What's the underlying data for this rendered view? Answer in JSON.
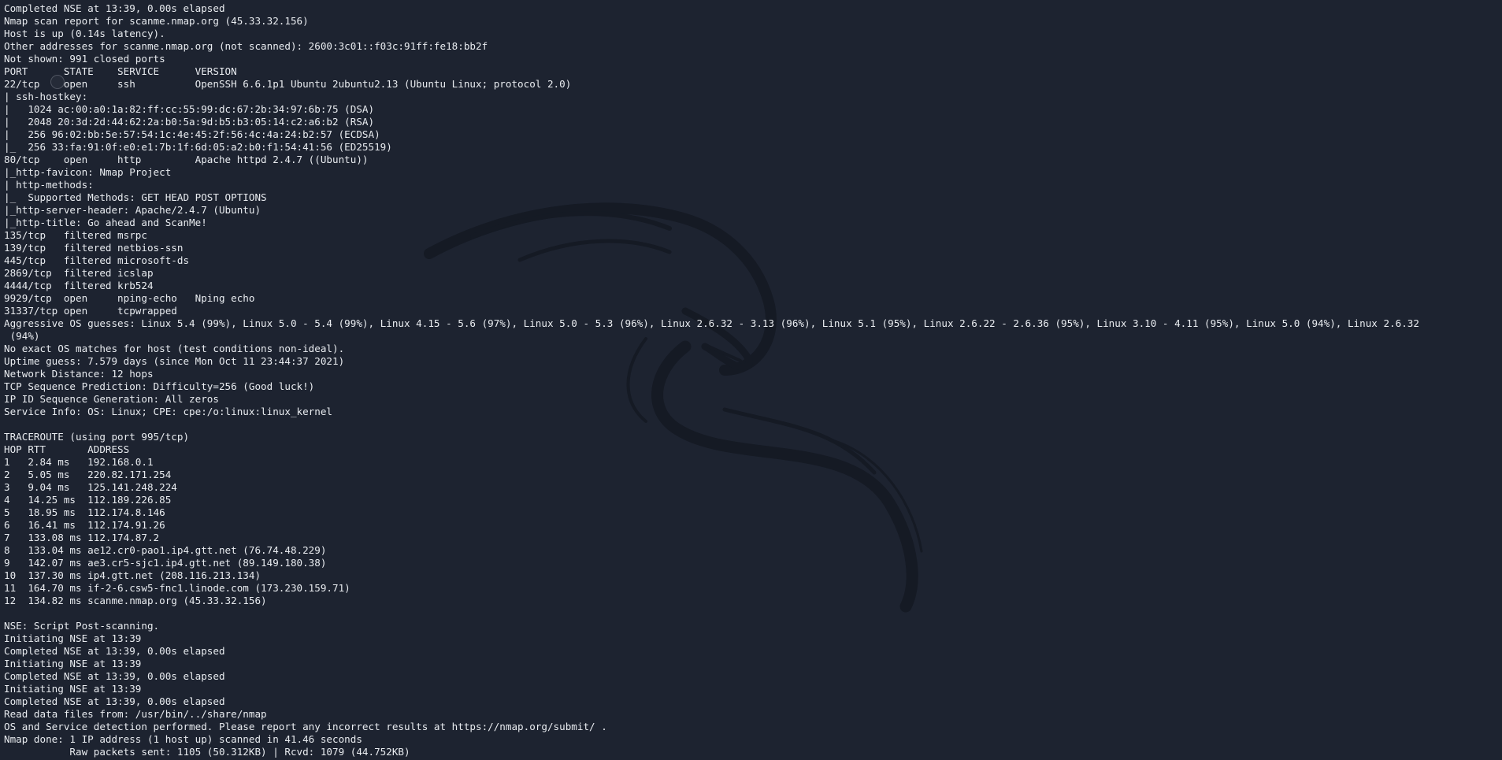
{
  "colors": {
    "background": "#1d2330",
    "text": "#e9ecf0",
    "dragon": "#151a24"
  },
  "wallpaper": {
    "icon": "kali-dragon-icon"
  },
  "terminal": {
    "lines": [
      "Completed NSE at 13:39, 0.00s elapsed",
      "Nmap scan report for scanme.nmap.org (45.33.32.156)",
      "Host is up (0.14s latency).",
      "Other addresses for scanme.nmap.org (not scanned): 2600:3c01::f03c:91ff:fe18:bb2f",
      "Not shown: 991 closed ports",
      "PORT      STATE    SERVICE      VERSION",
      "22/tcp    open     ssh          OpenSSH 6.6.1p1 Ubuntu 2ubuntu2.13 (Ubuntu Linux; protocol 2.0)",
      "| ssh-hostkey:",
      "|   1024 ac:00:a0:1a:82:ff:cc:55:99:dc:67:2b:34:97:6b:75 (DSA)",
      "|   2048 20:3d:2d:44:62:2a:b0:5a:9d:b5:b3:05:14:c2:a6:b2 (RSA)",
      "|   256 96:02:bb:5e:57:54:1c:4e:45:2f:56:4c:4a:24:b2:57 (ECDSA)",
      "|_  256 33:fa:91:0f:e0:e1:7b:1f:6d:05:a2:b0:f1:54:41:56 (ED25519)",
      "80/tcp    open     http         Apache httpd 2.4.7 ((Ubuntu))",
      "|_http-favicon: Nmap Project",
      "| http-methods:",
      "|_  Supported Methods: GET HEAD POST OPTIONS",
      "|_http-server-header: Apache/2.4.7 (Ubuntu)",
      "|_http-title: Go ahead and ScanMe!",
      "135/tcp   filtered msrpc",
      "139/tcp   filtered netbios-ssn",
      "445/tcp   filtered microsoft-ds",
      "2869/tcp  filtered icslap",
      "4444/tcp  filtered krb524",
      "9929/tcp  open     nping-echo   Nping echo",
      "31337/tcp open     tcpwrapped",
      "Aggressive OS guesses: Linux 5.4 (99%), Linux 5.0 - 5.4 (99%), Linux 4.15 - 5.6 (97%), Linux 5.0 - 5.3 (96%), Linux 2.6.32 - 3.13 (96%), Linux 5.1 (95%), Linux 2.6.22 - 2.6.36 (95%), Linux 3.10 - 4.11 (95%), Linux 5.0 (94%), Linux 2.6.32",
      " (94%)",
      "No exact OS matches for host (test conditions non-ideal).",
      "Uptime guess: 7.579 days (since Mon Oct 11 23:44:37 2021)",
      "Network Distance: 12 hops",
      "TCP Sequence Prediction: Difficulty=256 (Good luck!)",
      "IP ID Sequence Generation: All zeros",
      "Service Info: OS: Linux; CPE: cpe:/o:linux:linux_kernel",
      "",
      "TRACEROUTE (using port 995/tcp)",
      "HOP RTT       ADDRESS",
      "1   2.84 ms   192.168.0.1",
      "2   5.05 ms   220.82.171.254",
      "3   9.04 ms   125.141.248.224",
      "4   14.25 ms  112.189.226.85",
      "5   18.95 ms  112.174.8.146",
      "6   16.41 ms  112.174.91.26",
      "7   133.08 ms 112.174.87.2",
      "8   133.04 ms ae12.cr0-pao1.ip4.gtt.net (76.74.48.229)",
      "9   142.07 ms ae3.cr5-sjc1.ip4.gtt.net (89.149.180.38)",
      "10  137.30 ms ip4.gtt.net (208.116.213.134)",
      "11  164.70 ms if-2-6.csw5-fnc1.linode.com (173.230.159.71)",
      "12  134.82 ms scanme.nmap.org (45.33.32.156)",
      "",
      "NSE: Script Post-scanning.",
      "Initiating NSE at 13:39",
      "Completed NSE at 13:39, 0.00s elapsed",
      "Initiating NSE at 13:39",
      "Completed NSE at 13:39, 0.00s elapsed",
      "Initiating NSE at 13:39",
      "Completed NSE at 13:39, 0.00s elapsed",
      "Read data files from: /usr/bin/../share/nmap",
      "OS and Service detection performed. Please report any incorrect results at https://nmap.org/submit/ .",
      "Nmap done: 1 IP address (1 host up) scanned in 41.46 seconds",
      "           Raw packets sent: 1105 (50.312KB) | Rcvd: 1079 (44.752KB)"
    ]
  }
}
